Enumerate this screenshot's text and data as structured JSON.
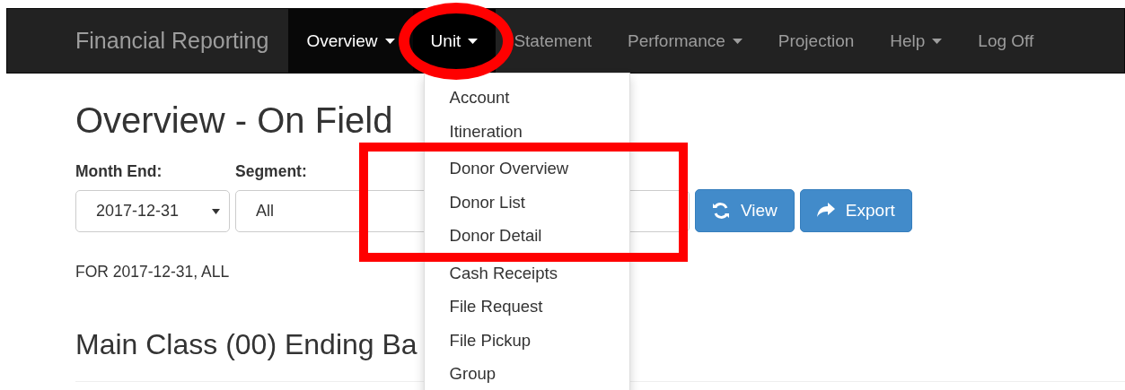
{
  "navbar": {
    "brand": "Financial Reporting",
    "items": [
      {
        "label": "Overview",
        "dropdown": true,
        "selected": true,
        "expanded": false,
        "circled": false
      },
      {
        "label": "Unit",
        "dropdown": true,
        "selected": false,
        "expanded": true,
        "circled": true,
        "menu": [
          {
            "highlighted": false,
            "items": [
              "Account",
              "Itineration"
            ]
          },
          {
            "highlighted": true,
            "items": [
              "Donor Overview",
              "Donor List",
              "Donor Detail"
            ]
          },
          {
            "highlighted": false,
            "items": [
              "Cash Receipts",
              "File Request",
              "File Pickup",
              "Group"
            ]
          }
        ]
      },
      {
        "label": "Statement",
        "dropdown": false,
        "selected": false,
        "expanded": false,
        "circled": false
      },
      {
        "label": "Performance",
        "dropdown": true,
        "selected": false,
        "expanded": false,
        "circled": false
      },
      {
        "label": "Projection",
        "dropdown": false,
        "selected": false,
        "expanded": false,
        "circled": false
      },
      {
        "label": "Help",
        "dropdown": true,
        "selected": false,
        "expanded": false,
        "circled": false
      },
      {
        "label": "Log Off",
        "dropdown": false,
        "selected": false,
        "expanded": false,
        "circled": false
      }
    ]
  },
  "page": {
    "title": "Overview - On Field",
    "filters": [
      {
        "label": "Month End:",
        "kind": "select",
        "value": "2017-12-31"
      },
      {
        "label": "Segment:",
        "kind": "text",
        "value": "All"
      }
    ],
    "buttons": [
      {
        "label": "View",
        "kind": "refresh"
      },
      {
        "label": "Export",
        "kind": "share"
      }
    ],
    "caption": "FOR 2017-12-31, ALL",
    "section_title": "Main Class (00) Ending Ba"
  }
}
